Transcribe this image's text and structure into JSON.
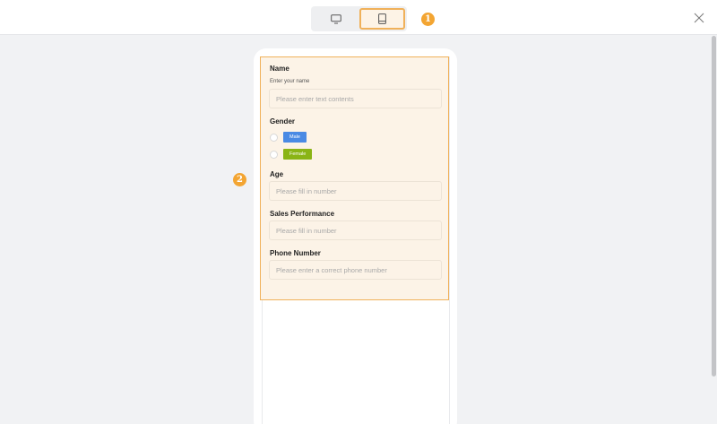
{
  "toolbar": {
    "desktop_icon": "desktop-icon",
    "mobile_icon": "mobile-icon",
    "badge_1": "1",
    "close_icon": "close-icon"
  },
  "preview": {
    "badge_2": "2",
    "fields": {
      "name": {
        "label": "Name",
        "description": "Enter your name",
        "placeholder": "Please enter text contents"
      },
      "gender": {
        "label": "Gender",
        "options": [
          {
            "label": "Male",
            "color": "#4a8ae4"
          },
          {
            "label": "Female",
            "color": "#8ab416"
          }
        ]
      },
      "age": {
        "label": "Age",
        "placeholder": "Please fill in number"
      },
      "sales": {
        "label": "Sales Performance",
        "placeholder": "Please fill in number"
      },
      "phone": {
        "label": "Phone Number",
        "placeholder": "Please enter a correct phone number"
      }
    }
  },
  "colors": {
    "accent": "#f3a532",
    "selected_border": "#f0b15a",
    "selected_bg": "#fcf3e7"
  }
}
